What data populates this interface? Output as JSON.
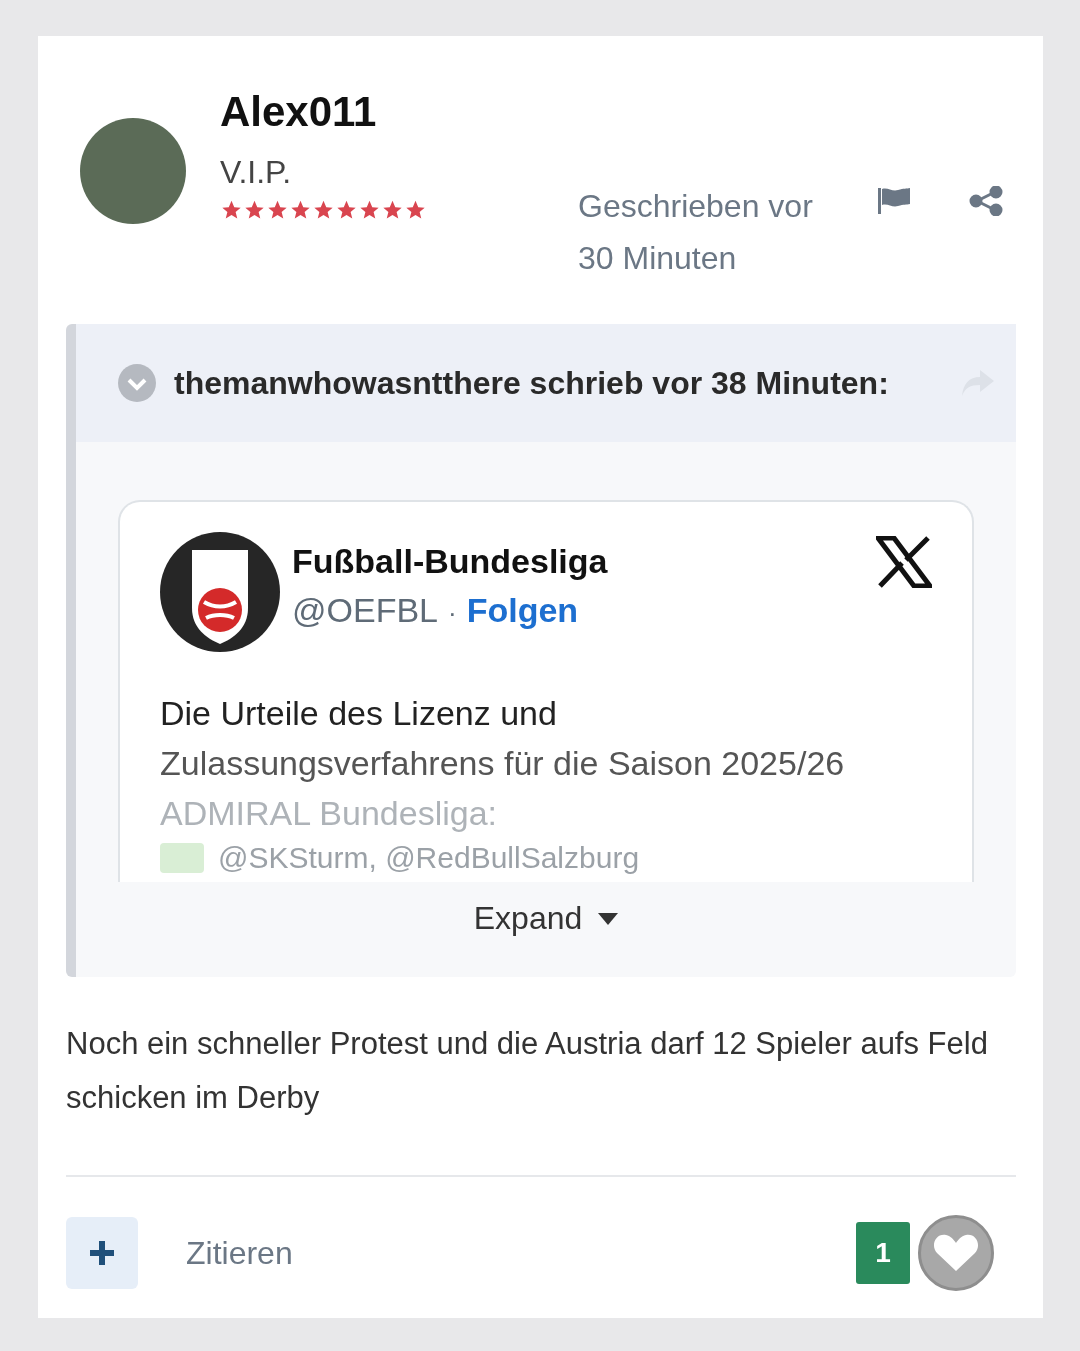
{
  "author": {
    "name": "Alex011",
    "rank": "V.I.P.",
    "stars": 9
  },
  "meta": {
    "posted": "Geschrieben vor 30 Minuten"
  },
  "quote": {
    "header": "themanwhowasntthere schrieb vor 38 Minuten:",
    "embed": {
      "name": "Fußball-Bundesliga",
      "handle": "@OEFBL",
      "separator": "·",
      "follow": "Folgen",
      "lines": [
        "Die Urteile des Lizenz und",
        "Zulassungsverfahrens für die Saison 2025/26",
        "ADMIRAL Bundesliga:",
        "@SKSturm, @RedBullSalzburg"
      ]
    },
    "expand": "Expand"
  },
  "body": "Noch ein schneller Protest und die Austria darf 12 Spieler aufs Feld schicken im Derby",
  "footer": {
    "quote_label": "Zitieren",
    "reaction_count": "1"
  }
}
